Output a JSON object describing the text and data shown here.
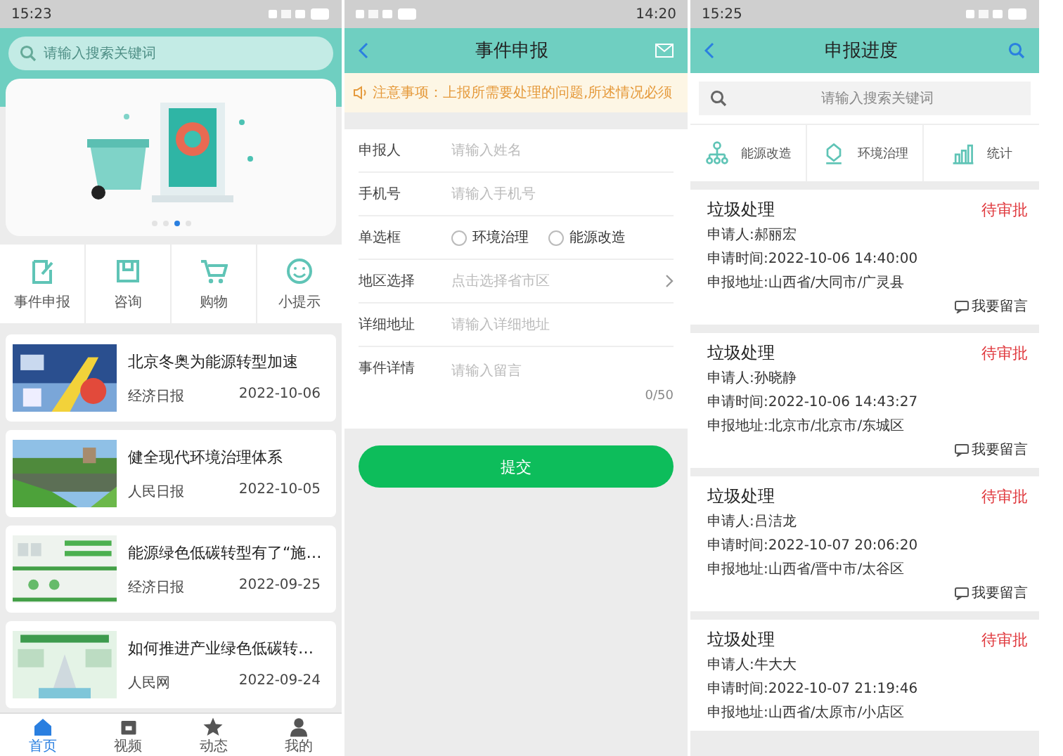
{
  "home": {
    "status_time": "15:23",
    "search": {
      "placeholder": "请输入搜索关键词"
    },
    "banner_dots": [
      {
        "selected": false
      },
      {
        "selected": false
      },
      {
        "selected": true
      },
      {
        "selected": false
      }
    ],
    "shortcuts": [
      "事件申报",
      "咨询",
      "购物",
      "小提示"
    ],
    "news": [
      {
        "title": "北京冬奥为能源转型加速",
        "source": "经济日报",
        "date": "2022-10-06"
      },
      {
        "title": "健全现代环境治理体系",
        "source": "人民日报",
        "date": "2022-10-05"
      },
      {
        "title": "能源绿色低碳转型有了“施…",
        "source": "经济日报",
        "date": "2022-09-25"
      },
      {
        "title": "如何推进产业绿色低碳转…",
        "source": "人民网",
        "date": "2022-09-24"
      }
    ],
    "tabs": [
      {
        "label": "首页",
        "selected": true
      },
      {
        "label": "视频",
        "selected": false
      },
      {
        "label": "动态",
        "selected": false
      },
      {
        "label": "我的",
        "selected": false
      }
    ]
  },
  "report_form": {
    "status_time": "14:20",
    "title": "事件申报",
    "notice": "注意事项：上报所需要处理的问题,所述情况必须",
    "fields": [
      {
        "label": "申报人",
        "kind": "text",
        "placeholder": "请输入姓名"
      },
      {
        "label": "手机号",
        "kind": "text",
        "placeholder": "请输入手机号"
      },
      {
        "label": "单选框",
        "kind": "radio",
        "options": [
          {
            "label": "环境治理",
            "checked": false
          },
          {
            "label": "能源改造",
            "checked": false
          }
        ]
      },
      {
        "label": "地区选择",
        "kind": "picker",
        "placeholder": "点击选择省市区"
      },
      {
        "label": "详细地址",
        "kind": "text",
        "placeholder": "请输入详细地址"
      },
      {
        "label": "事件详情",
        "kind": "textarea",
        "placeholder": "请输入留言",
        "counter": "0/50"
      }
    ],
    "submit": "提交"
  },
  "progress": {
    "status_time": "15:25",
    "title": "申报进度",
    "search": {
      "placeholder": "请输入搜索关键词"
    },
    "categories": [
      "能源改造",
      "环境治理",
      "统计"
    ],
    "records": [
      {
        "title": "垃圾处理",
        "status": "待审批",
        "applicant": "申请人:郝丽宏",
        "time": "申请时间:2022-10-06 14:40:00",
        "address": "申报地址:山西省/大同市/广灵县",
        "comment": "我要留言"
      },
      {
        "title": "垃圾处理",
        "status": "待审批",
        "applicant": "申请人:孙晓静",
        "time": "申请时间:2022-10-06 14:43:27",
        "address": "申报地址:北京市/北京市/东城区",
        "comment": "我要留言"
      },
      {
        "title": "垃圾处理",
        "status": "待审批",
        "applicant": "申请人:吕洁龙",
        "time": "申请时间:2022-10-07 20:06:20",
        "address": "申报地址:山西省/晋中市/太谷区",
        "comment": "我要留言"
      },
      {
        "title": "垃圾处理",
        "status": "待审批",
        "applicant": "申请人:牛大大",
        "time": "申请时间:2022-10-07 21:19:46",
        "address": "申报地址:山西省/太原市/小店区"
      }
    ]
  }
}
